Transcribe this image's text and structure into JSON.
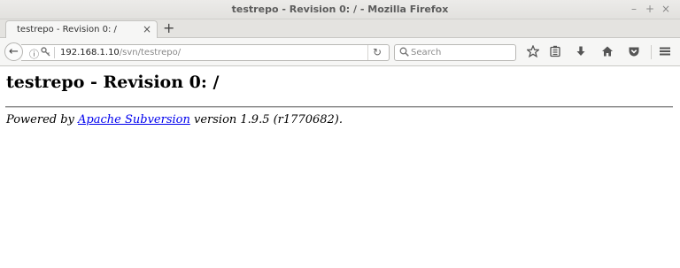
{
  "window": {
    "title": "testrepo - Revision 0: / - Mozilla Firefox",
    "controls": {
      "minimize": "–",
      "maximize": "+",
      "close": "×"
    }
  },
  "tab": {
    "label": "testrepo - Revision 0: /",
    "close": "×",
    "new_tab": "+"
  },
  "navbar": {
    "back": "←",
    "url_host": "192.168.1.10",
    "url_path": "/svn/testrepo/",
    "reload": "↻",
    "search_placeholder": "Search",
    "icons": [
      "bookmark-star-icon",
      "reading-list-icon",
      "download-icon",
      "home-icon",
      "pocket-icon",
      "menu-icon"
    ]
  },
  "page": {
    "heading": "testrepo - Revision 0: /",
    "footer_prefix": "Powered by ",
    "footer_link": "Apache Subversion",
    "footer_suffix": " version 1.9.5 (r1770682)."
  }
}
